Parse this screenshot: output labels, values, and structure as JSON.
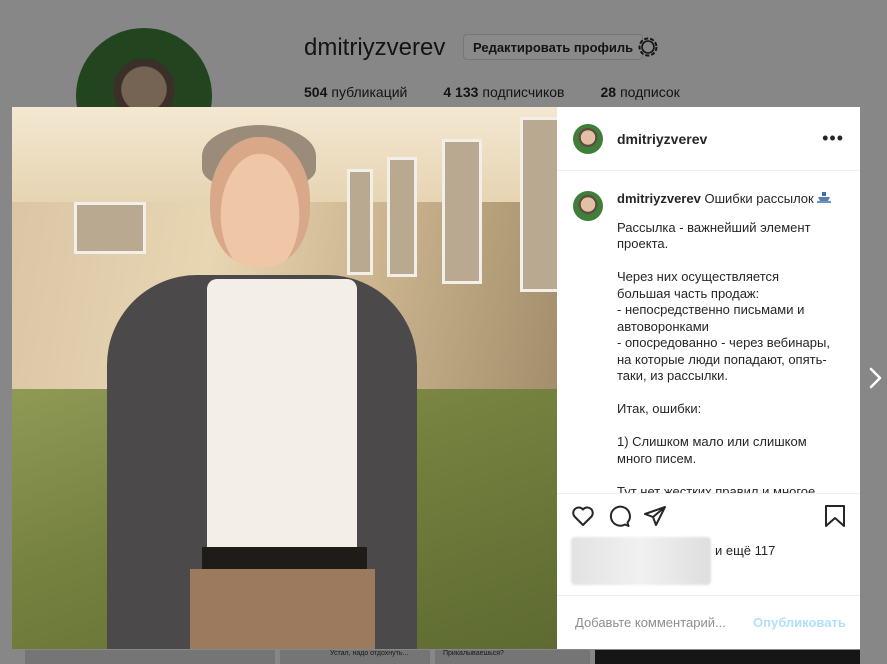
{
  "profile": {
    "username": "dmitriyzverev",
    "edit_button": "Редактировать профиль",
    "stats": {
      "posts_count": "504",
      "posts_label": "публикаций",
      "followers_count": "4 133",
      "followers_label": "подписчиков",
      "following_count": "28",
      "following_label": "подписок"
    },
    "thumbs": [
      "Устал, надо отдохнуть...",
      "Прикалываешься?"
    ]
  },
  "post": {
    "username": "dmitriyzverev",
    "caption_title": "Ошибки рассылок",
    "caption_text": "Рассылка - важнейший элемент проекта.\n\nЧерез них осуществляется большая часть продаж:\n- непосредственно письмами и автоворонками\n- опосредованно - через вебинары, на которые люди попадают, опять-таки, из рассылки.\n\nИтак, ошибки:\n\n1) Слишком мало или слишком много писем.\n\nТут нет жестких правил и многое",
    "likes_text": "и ещё 117",
    "comment_placeholder": "Добавьте комментарий...",
    "publish_label": "Опубликовать"
  },
  "icons": [
    "gear-icon",
    "more-icon",
    "heart-icon",
    "comment-icon",
    "share-icon",
    "bookmark-icon",
    "chevron-right-icon",
    "ship-icon"
  ]
}
